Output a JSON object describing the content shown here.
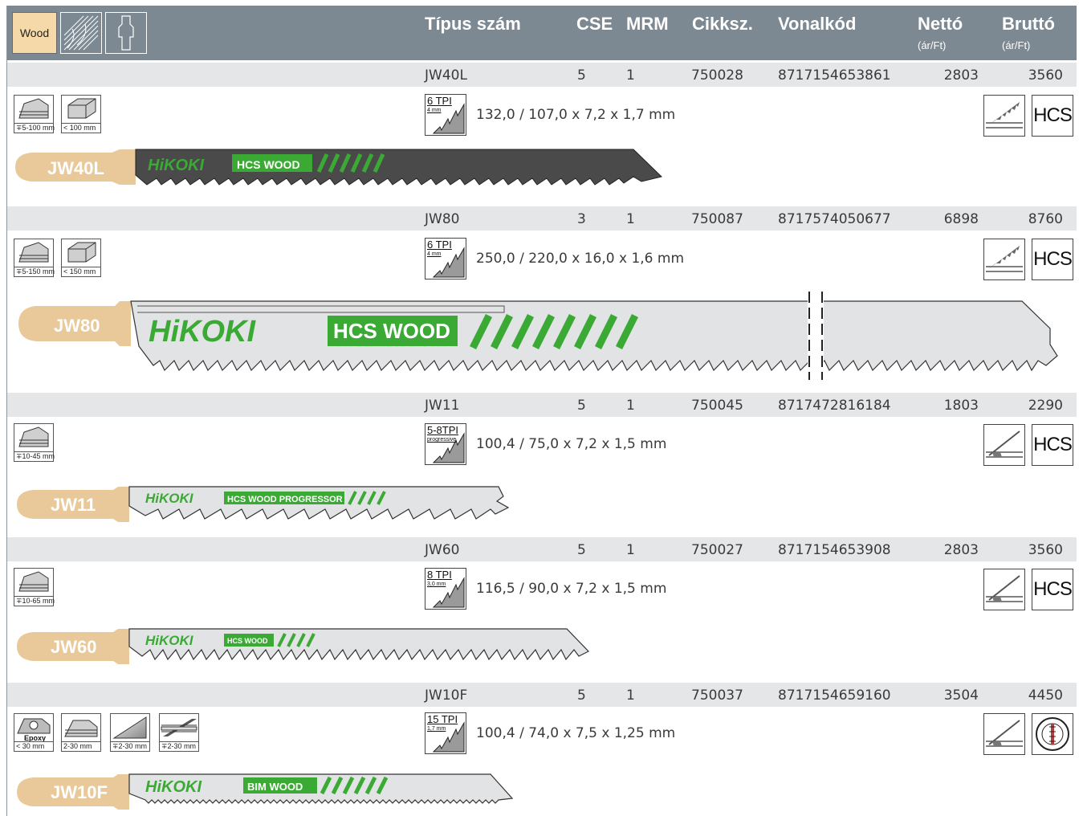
{
  "header": {
    "category": "Wood",
    "columns": {
      "type": "Típus szám",
      "cse": "CSE",
      "mrm": "MRM",
      "article": "Cikksz.",
      "barcode": "Vonalkód",
      "net": "Nettó",
      "net_unit": "(ár/Ft)",
      "gross": "Bruttó",
      "gross_unit": "(ár/Ft)"
    }
  },
  "brand": "HiKOKI",
  "colors": {
    "header_bg": "#7d8992",
    "band_bg": "#e5e6e8",
    "brand_green": "#3aaa35",
    "shank": "#e9c99a"
  },
  "rows": [
    {
      "type": "JW40L",
      "cse": "5",
      "mrm": "1",
      "article": "750028",
      "barcode": "8717154653861",
      "net": "2803",
      "gross": "3560",
      "materials": [
        "∓5-100 mm",
        "< 100 mm"
      ],
      "tpi": "6 TPI",
      "pitch": "4 mm",
      "dims": "132,0 / 107,0 x 7,2 x 1,7 mm",
      "cut_icon": "coarse-cut-icon",
      "steel": "HCS",
      "blade_label": "HCS  WOOD",
      "blade_color": "dark"
    },
    {
      "type": "JW80",
      "cse": "3",
      "mrm": "1",
      "article": "750087",
      "barcode": "8717574050677",
      "net": "6898",
      "gross": "8760",
      "materials": [
        "∓5-150 mm",
        "< 150 mm"
      ],
      "tpi": "6 TPI",
      "pitch": "4 mm",
      "dims": "250,0 / 220,0 x 16,0 x 1,6 mm",
      "cut_icon": "coarse-cut-icon",
      "steel": "HCS",
      "blade_label": "HCS  WOOD",
      "blade_color": "light"
    },
    {
      "type": "JW11",
      "cse": "5",
      "mrm": "1",
      "article": "750045",
      "barcode": "8717472816184",
      "net": "1803",
      "gross": "2290",
      "materials": [
        "∓10-45 mm"
      ],
      "tpi": "5-8TPI",
      "pitch": "progressive",
      "dims": "100,4 / 75,0 x 7,2 x 1,5 mm",
      "cut_icon": "clean-cut-icon",
      "steel": "HCS",
      "blade_label": "HCS  WOOD  PROGRESSOR",
      "blade_color": "light"
    },
    {
      "type": "JW60",
      "cse": "5",
      "mrm": "1",
      "article": "750027",
      "barcode": "8717154653908",
      "net": "2803",
      "gross": "3560",
      "materials": [
        "∓10-65 mm"
      ],
      "tpi": "8 TPI",
      "pitch": "3,0 mm",
      "dims": "116,5 / 90,0 x 7,2 x 1,5 mm",
      "cut_icon": "clean-cut-icon",
      "steel": "HCS",
      "blade_label": "HCS  WOOD",
      "blade_color": "light"
    },
    {
      "type": "JW10F",
      "cse": "5",
      "mrm": "1",
      "article": "750037",
      "barcode": "8717154659160",
      "net": "3504",
      "gross": "4450",
      "materials": [
        "< 30 mm",
        "2-30 mm",
        "∓2-30 mm",
        "∓2-30 mm"
      ],
      "material_extra": "Epoxy",
      "tpi": "15 TPI",
      "pitch": "1,7 mm",
      "dims": "100,4 / 74,0 x 7,5 x 1,25 mm",
      "cut_icon": "clean-cut-icon",
      "steel": "BIM",
      "blade_label": "BIM  WOOD",
      "blade_color": "light"
    }
  ]
}
